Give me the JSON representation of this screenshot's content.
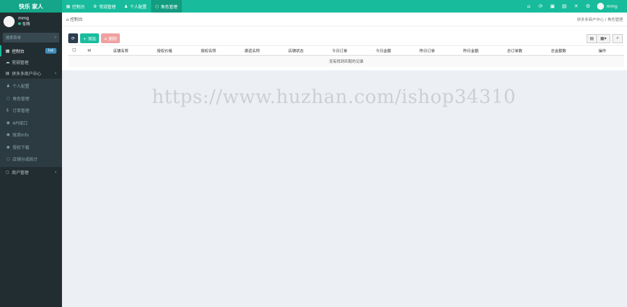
{
  "app": {
    "logo": "快乐  家人"
  },
  "topnav": [
    {
      "icon": "dashboard-icon",
      "glyph": "▦",
      "label": "控制台",
      "active": false
    },
    {
      "icon": "cogs-icon",
      "glyph": "⚙",
      "label": "常规管理",
      "active": false
    },
    {
      "icon": "user-icon",
      "glyph": "♟",
      "label": "个人配置",
      "active": false
    },
    {
      "icon": "circle-icon",
      "glyph": "○",
      "label": "角色管理",
      "active": true
    }
  ],
  "topright": {
    "icons": [
      "home-icon",
      "refresh-icon",
      "trash-icon",
      "print-icon",
      "fullscreen-icon",
      "settings-icon"
    ],
    "username": "mmg"
  },
  "sidebar": {
    "username": "mmg",
    "status": "在线",
    "search_placeholder": "搜索菜单",
    "menu": [
      {
        "icon": "dashboard-icon",
        "glyph": "▦",
        "label": "控制台",
        "badge": "hot",
        "active": true
      },
      {
        "icon": "cloud-icon",
        "glyph": "☁",
        "label": "常规管理",
        "badge": "",
        "active": false
      },
      {
        "icon": "file-icon",
        "glyph": "▤",
        "label": "拼多多商户中心",
        "badge": "",
        "active": false,
        "chevron": "‹"
      }
    ],
    "submenu": [
      {
        "icon": "user-icon",
        "glyph": "♟",
        "label": "个人配置"
      },
      {
        "icon": "circle-icon",
        "glyph": "○",
        "label": "角色管理"
      },
      {
        "icon": "dollar-icon",
        "glyph": "$",
        "label": "订单管理"
      },
      {
        "icon": "api-icon",
        "glyph": "◉",
        "label": "API接口"
      },
      {
        "icon": "account-icon",
        "glyph": "◉",
        "label": "账单Info"
      },
      {
        "icon": "download-icon",
        "glyph": "◉",
        "label": "授权下载"
      },
      {
        "icon": "stats-icon",
        "glyph": "○",
        "label": "店铺分成统计"
      }
    ],
    "bottom_menu": [
      {
        "icon": "circle-icon",
        "glyph": "○",
        "label": "商户管理",
        "chevron": "‹"
      }
    ]
  },
  "breadcrumb": {
    "home": "控制台",
    "trail": "拼多多商户中心  /  角色管理"
  },
  "toolbar": {
    "refresh": "⟳",
    "add": "+ 添加",
    "delete": "✕ 删除",
    "view_table": "▤",
    "columns": "▦▾",
    "search": "⌕"
  },
  "table": {
    "columns": [
      "",
      "id",
      "店铺名称",
      "授权价格",
      "授权名称",
      "渠道名称",
      "店铺状态",
      "今日订单",
      "今日金额",
      "昨日订单",
      "昨日金额",
      "总订单数",
      "总金额数",
      "操作"
    ],
    "empty_text": "没有找到匹配的记录"
  },
  "watermark": "https://www.huzhan.com/ishop34310"
}
